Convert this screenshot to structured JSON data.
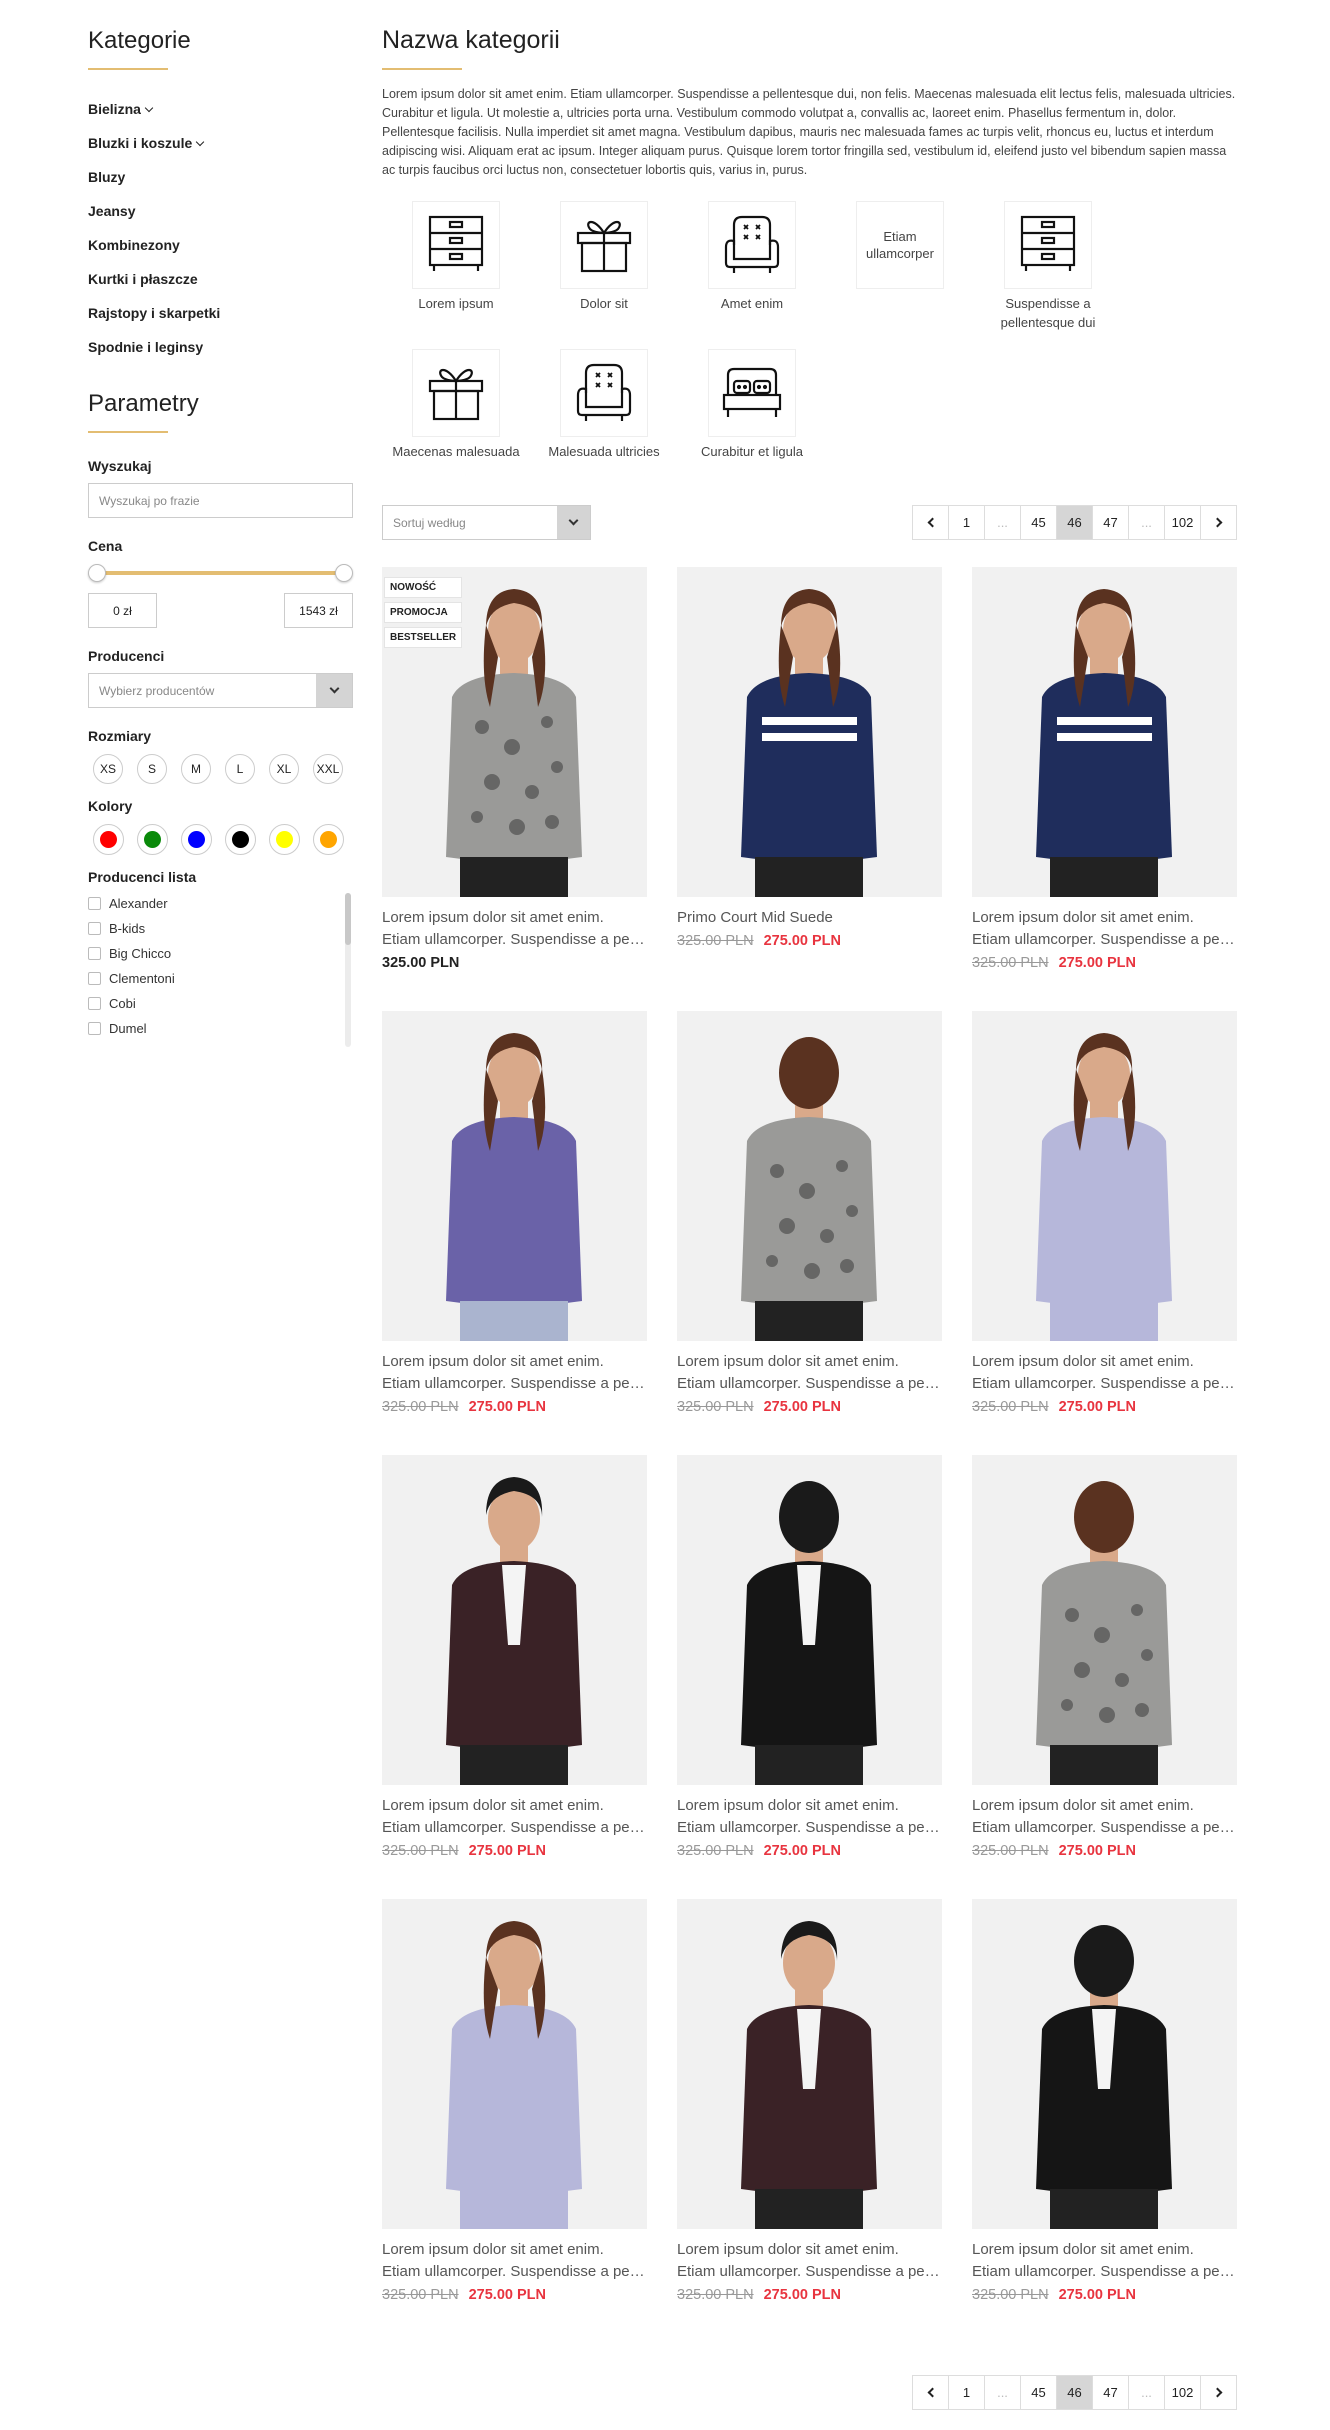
{
  "sidebar": {
    "categories_title": "Kategorie",
    "categories": [
      {
        "label": "Bielizna",
        "expandable": true
      },
      {
        "label": "Bluzki i koszule",
        "expandable": true
      },
      {
        "label": "Bluzy",
        "expandable": false
      },
      {
        "label": "Jeansy",
        "expandable": false
      },
      {
        "label": "Kombinezony",
        "expandable": false
      },
      {
        "label": "Kurtki i płaszcze",
        "expandable": false
      },
      {
        "label": "Rajstopy i skarpetki",
        "expandable": false
      },
      {
        "label": "Spodnie i leginsy",
        "expandable": false
      }
    ],
    "params_title": "Parametry",
    "search_label": "Wyszukaj",
    "search_placeholder": "Wyszukaj po frazie",
    "price_label": "Cena",
    "price_min": "0 zł",
    "price_max": "1543 zł",
    "producers_label": "Producenci",
    "producers_placeholder": "Wybierz producentów",
    "sizes_label": "Rozmiary",
    "sizes": [
      "XS",
      "S",
      "M",
      "L",
      "XL",
      "XXL"
    ],
    "colors_label": "Kolory",
    "colors": [
      "#ff0000",
      "#0a8a0a",
      "#0000ff",
      "#000000",
      "#ffff00",
      "#ffa500"
    ],
    "producer_list_label": "Producenci lista",
    "producer_list": [
      "Alexander",
      "B-kids",
      "Big Chicco",
      "Clementoni",
      "Cobi",
      "Dumel"
    ]
  },
  "main": {
    "title": "Nazwa kategorii",
    "description": "Lorem ipsum dolor sit amet enim. Etiam ullamcorper. Suspendisse a pellentesque dui, non felis. Maecenas malesuada elit lectus felis, malesuada ultricies. Curabitur et ligula. Ut molestie a, ultricies porta urna. Vestibulum commodo volutpat a, convallis ac, laoreet enim. Phasellus fermentum in, dolor. Pellentesque facilisis. Nulla imperdiet sit amet magna. Vestibulum dapibus, mauris nec malesuada fames ac turpis velit, rhoncus eu, luctus et interdum adipiscing wisi. Aliquam erat ac ipsum. Integer aliquam purus. Quisque lorem tortor fringilla sed, vestibulum id, eleifend justo vel bibendum sapien massa ac turpis faucibus orci luctus non, consectetuer lobortis quis, varius in, purus.",
    "subcategories": [
      {
        "label": "Lorem ipsum",
        "icon": "dresser-icon"
      },
      {
        "label": "Dolor sit",
        "icon": "gift-icon"
      },
      {
        "label": "Amet enim",
        "icon": "armchair-icon"
      },
      {
        "label": "",
        "icon": "none",
        "tile_text": "Etiam ullamcorper"
      },
      {
        "label": "Suspendisse a pellentesque dui",
        "icon": "dresser-icon"
      },
      {
        "label": "Maecenas malesuada",
        "icon": "gift-icon"
      },
      {
        "label": "Malesuada ultricies",
        "icon": "armchair-icon"
      },
      {
        "label": "Curabitur et ligula",
        "icon": "bed-icon"
      }
    ],
    "sort_placeholder": "Sortuj według",
    "pagination": [
      "1",
      "...",
      "45",
      "46",
      "47",
      "...",
      "102"
    ],
    "current_page": "46",
    "products": [
      {
        "name1": "Lorem ipsum dolor sit amet enim.",
        "name2": "Etiam ullamcorper. Suspendisse a pellentesque dui",
        "old_price": "",
        "price": "325.00 PLN",
        "badges": [
          "NOWOŚĆ",
          "PROMOCJA",
          "BESTSELLER"
        ],
        "image": "woman-butterfly-print-top-front"
      },
      {
        "name1": "Primo Court Mid Suede",
        "name2": "",
        "old_price": "325.00 PLN",
        "price": "275.00 PLN",
        "badges": [],
        "image": "woman-navy-striped-top-side"
      },
      {
        "name1": "Lorem ipsum dolor sit amet enim.",
        "name2": "Etiam ullamcorper. Suspendisse a pellentesque dui",
        "old_price": "325.00 PLN",
        "price": "275.00 PLN",
        "badges": [],
        "image": "woman-navy-striped-top-front"
      },
      {
        "name1": "Lorem ipsum dolor sit amet enim.",
        "name2": "Etiam ullamcorper. Suspendisse a pellentesque dui",
        "old_price": "325.00 PLN",
        "price": "275.00 PLN",
        "badges": [],
        "image": "woman-purple-tshirt"
      },
      {
        "name1": "Lorem ipsum dolor sit amet enim.",
        "name2": "Etiam ullamcorper. Suspendisse a pellentesque dui",
        "old_price": "325.00 PLN",
        "price": "275.00 PLN",
        "badges": [],
        "image": "woman-butterfly-print-top-back"
      },
      {
        "name1": "Lorem ipsum dolor sit amet enim.",
        "name2": "Etiam ullamcorper. Suspendisse a pellentesque dui",
        "old_price": "325.00 PLN",
        "price": "275.00 PLN",
        "badges": [],
        "image": "woman-lavender-shirt-front"
      },
      {
        "name1": "Lorem ipsum dolor sit amet enim.",
        "name2": "Etiam ullamcorper. Suspendisse a pellentesque dui",
        "old_price": "325.00 PLN",
        "price": "275.00 PLN",
        "badges": [],
        "image": "man-burgundy-blazer-side"
      },
      {
        "name1": "Lorem ipsum dolor sit amet enim.",
        "name2": "Etiam ullamcorper. Suspendisse a pellentesque dui",
        "old_price": "325.00 PLN",
        "price": "275.00 PLN",
        "badges": [],
        "image": "man-black-blazer-back"
      },
      {
        "name1": "Lorem ipsum dolor sit amet enim.",
        "name2": "Etiam ullamcorper. Suspendisse a pellentesque dui",
        "old_price": "325.00 PLN",
        "price": "275.00 PLN",
        "badges": [],
        "image": "woman-butterfly-print-top-back"
      },
      {
        "name1": "Lorem ipsum dolor sit amet enim.",
        "name2": "Etiam ullamcorper. Suspendisse a pellentesque dui",
        "old_price": "325.00 PLN",
        "price": "275.00 PLN",
        "badges": [],
        "image": "woman-lavender-shirt-side"
      },
      {
        "name1": "Lorem ipsum dolor sit amet enim.",
        "name2": "Etiam ullamcorper. Suspendisse a pellentesque dui",
        "old_price": "325.00 PLN",
        "price": "275.00 PLN",
        "badges": [],
        "image": "man-burgundy-blazer-front"
      },
      {
        "name1": "Lorem ipsum dolor sit amet enim.",
        "name2": "Etiam ullamcorper. Suspendisse a pellentesque dui",
        "old_price": "325.00 PLN",
        "price": "275.00 PLN",
        "badges": [],
        "image": "man-black-blazer-back"
      }
    ]
  }
}
